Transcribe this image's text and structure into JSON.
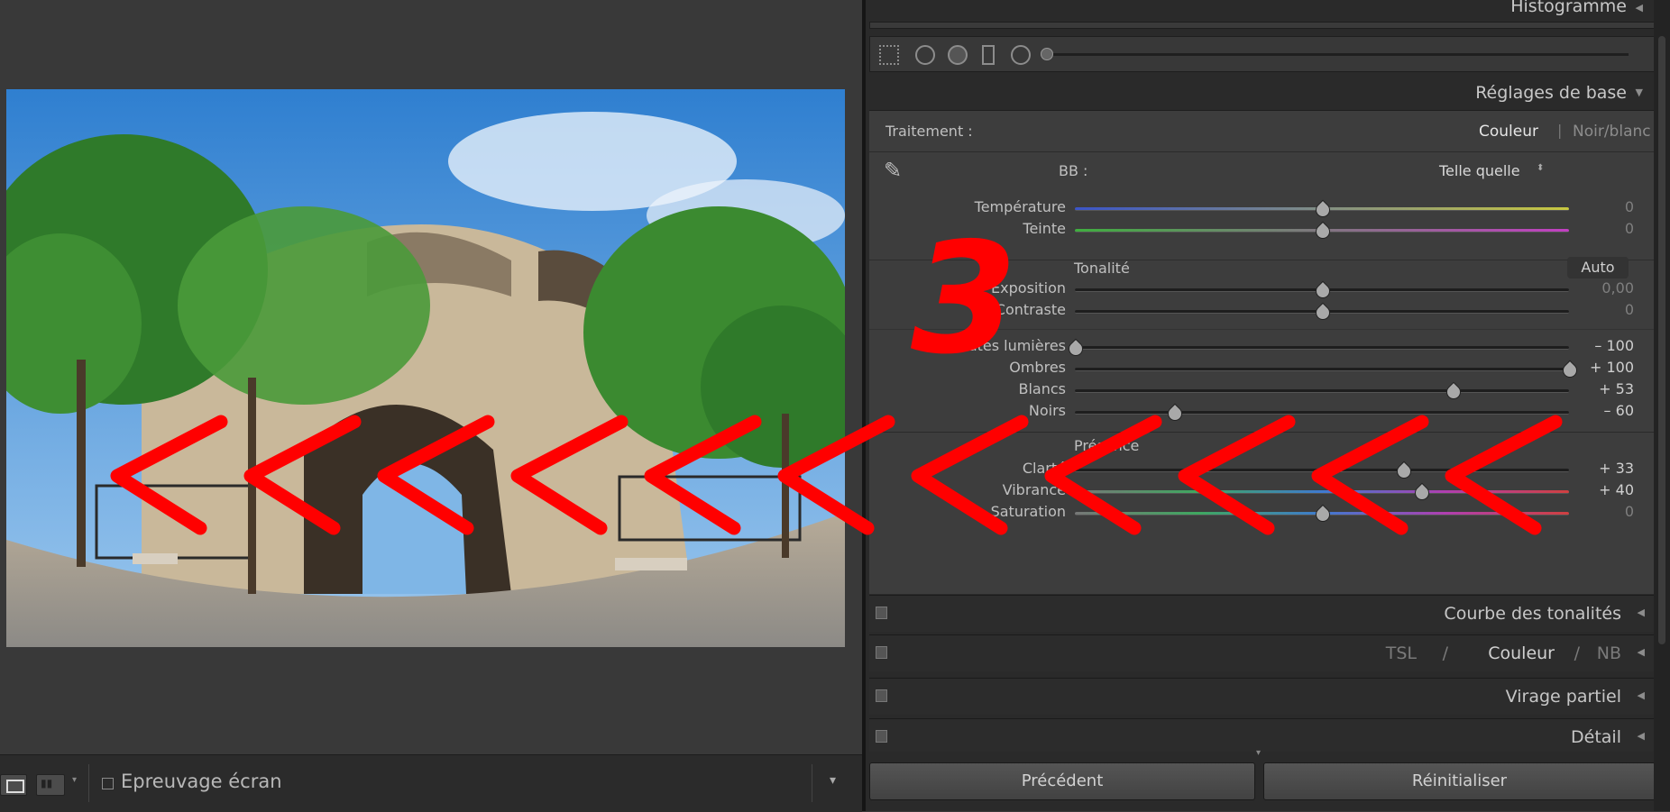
{
  "toolbar": {
    "soft_proof_label": "Epreuvage écran"
  },
  "panel": {
    "histogram_title": "Histogramme",
    "basic_title": "Réglages de base",
    "treatment_label": "Traitement :",
    "treatment_color": "Couleur",
    "treatment_bw": "Noir/blanc",
    "wb_label": "BB :",
    "wb_value": "Telle quelle",
    "temperature_label": "Température",
    "temperature_value": "0",
    "tint_label": "Teinte",
    "tint_value": "0",
    "tone_label": "Tonalité",
    "auto_button": "Auto",
    "exposure_label": "Exposition",
    "exposure_value": "0,00",
    "contrast_label": "Contraste",
    "contrast_value": "0",
    "highlights_label": "Hautes lumières",
    "highlights_value": "– 100",
    "shadows_label": "Ombres",
    "shadows_value": "+ 100",
    "whites_label": "Blancs",
    "whites_value": "+ 53",
    "blacks_label": "Noirs",
    "blacks_value": "– 60",
    "presence_label": "Présence",
    "clarity_label": "Clarté",
    "clarity_value": "+ 33",
    "vibrance_label": "Vibrance",
    "vibrance_value": "+ 40",
    "saturation_label": "Saturation",
    "saturation_value": "0",
    "tone_curve_title": "Courbe des tonalités",
    "hsl_tsl": "TSL",
    "hsl_sep": "/",
    "hsl_color": "Couleur",
    "hsl_nb": "NB",
    "split_toning_title": "Virage partiel",
    "detail_title": "Détail",
    "previous_button": "Précédent",
    "reset_button": "Réinitialiser"
  },
  "sliders": {
    "temperature": 0.5,
    "tint": 0.5,
    "exposure": 0.5,
    "contrast": 0.5,
    "highlights": 0.0,
    "shadows": 1.0,
    "whites": 0.765,
    "blacks": 0.2,
    "clarity": 0.665,
    "vibrance": 0.7,
    "saturation": 0.5
  },
  "annotation": {
    "number": "3",
    "color": "#ff0000"
  }
}
